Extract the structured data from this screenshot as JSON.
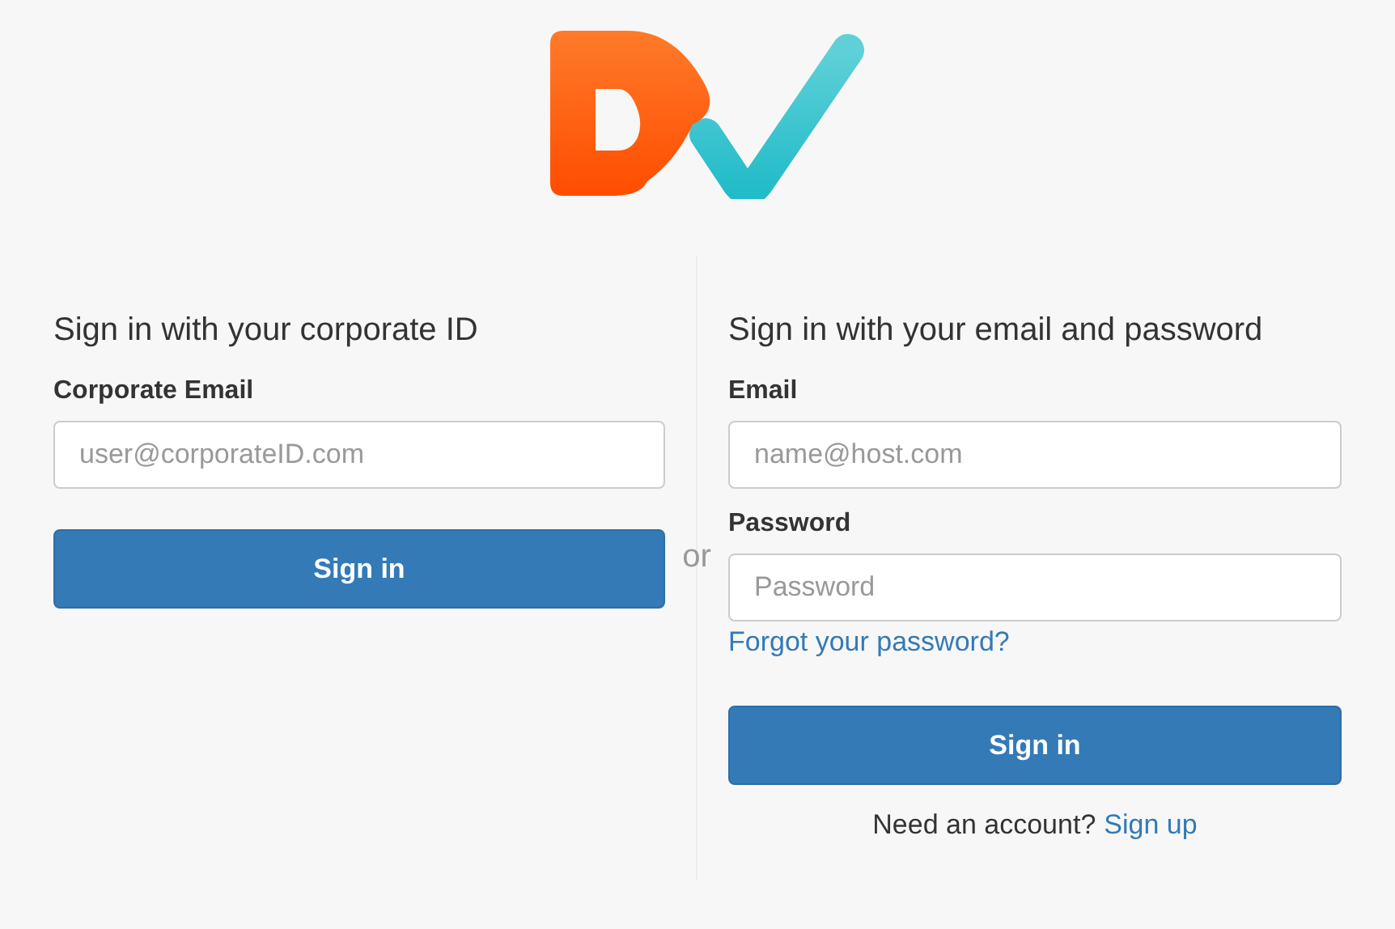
{
  "corporate": {
    "heading": "Sign in with your corporate ID",
    "email_label": "Corporate Email",
    "email_placeholder": "user@corporateID.com",
    "button": "Sign in"
  },
  "separator": "or",
  "account": {
    "heading": "Sign in with your email and password",
    "email_label": "Email",
    "email_placeholder": "name@host.com",
    "password_label": "Password",
    "password_placeholder": "Password",
    "forgot_link": "Forgot your password?",
    "button": "Sign in",
    "signup_prompt": "Need an account?",
    "signup_link": "Sign up"
  }
}
